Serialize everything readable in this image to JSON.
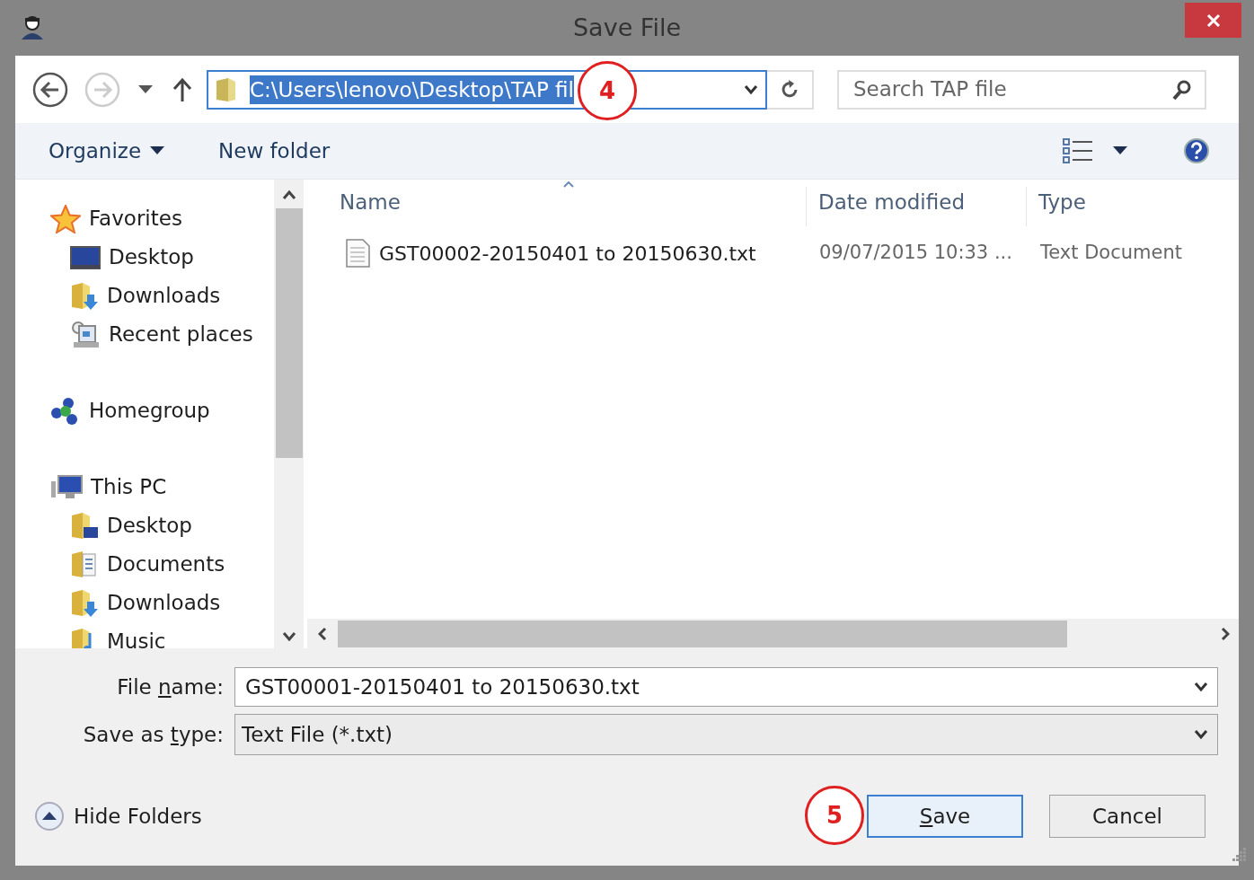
{
  "window": {
    "title": "Save File"
  },
  "address_bar": {
    "path": "C:\\Users\\lenovo\\Desktop\\TAP fil",
    "selected": true
  },
  "search": {
    "placeholder": "Search TAP file"
  },
  "toolbar": {
    "organize": "Organize",
    "new_folder": "New folder"
  },
  "sidebar": {
    "items": [
      {
        "label": "Favorites",
        "kind": "star",
        "children": [
          {
            "label": "Desktop",
            "kind": "desktop"
          },
          {
            "label": "Downloads",
            "kind": "downloads"
          },
          {
            "label": "Recent places",
            "kind": "recent"
          }
        ]
      },
      {
        "label": "Homegroup",
        "kind": "homegroup"
      },
      {
        "label": "This PC",
        "kind": "pc",
        "children": [
          {
            "label": "Desktop",
            "kind": "folder"
          },
          {
            "label": "Documents",
            "kind": "documents"
          },
          {
            "label": "Downloads",
            "kind": "downloads"
          },
          {
            "label": "Music",
            "kind": "music"
          }
        ]
      }
    ]
  },
  "table": {
    "columns": [
      "Name",
      "Date modified",
      "Type"
    ],
    "rows": [
      {
        "name": "GST00002-20150401 to 20150630.txt",
        "date_modified": "09/07/2015 10:33 ...",
        "type": "Text Document"
      }
    ]
  },
  "file_name": {
    "label_before": "File ",
    "access_key": "n",
    "label_after": "ame:",
    "value": "GST00001-20150401 to 20150630.txt"
  },
  "save_as_type": {
    "label_before": "Save as ",
    "access_key": "t",
    "label_after": "ype:",
    "value": "Text File (*.txt)"
  },
  "hide_folders": "Hide Folders",
  "buttons": [
    {
      "access_key": "S",
      "label_after": "ave",
      "kind": "default"
    },
    {
      "label_after": "Cancel",
      "kind": "normal"
    }
  ],
  "callouts": [
    {
      "text": "4"
    },
    {
      "text": "5"
    }
  ]
}
